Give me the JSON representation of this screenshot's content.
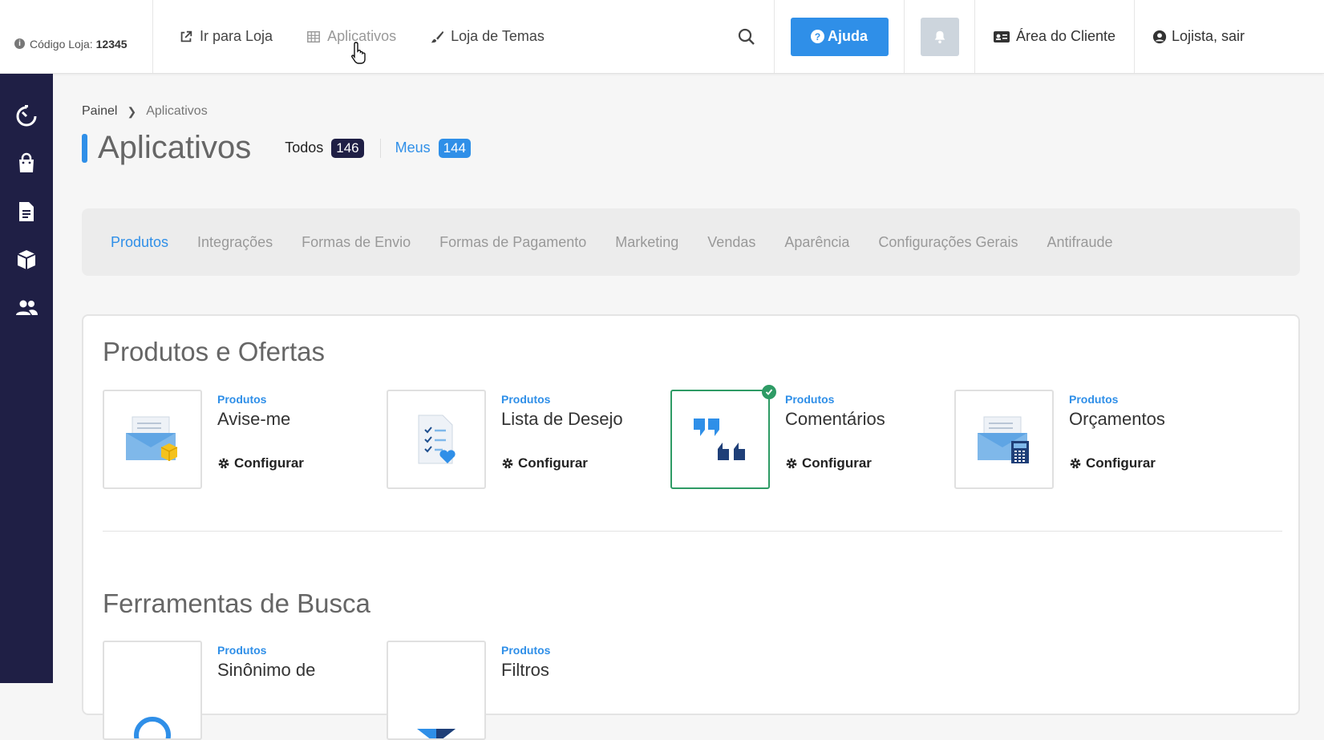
{
  "topbar": {
    "store_code_label": "Código Loja:",
    "store_code_value": "12345",
    "nav": [
      {
        "label": "Ir para Loja",
        "icon": "external-link-icon"
      },
      {
        "label": "Aplicativos",
        "icon": "grid-icon"
      },
      {
        "label": "Loja de Temas",
        "icon": "brush-icon"
      }
    ],
    "help_label": "Ajuda",
    "client_area_label": "Área do Cliente",
    "user_label": "Lojista, sair"
  },
  "sidebar": {
    "items": [
      "dashboard-icon",
      "shopping-bag-icon",
      "document-icon",
      "box-icon",
      "users-icon"
    ]
  },
  "breadcrumb": {
    "root": "Painel",
    "current": "Aplicativos"
  },
  "page": {
    "title": "Aplicativos",
    "all_label": "Todos",
    "all_count": "146",
    "mine_label": "Meus",
    "mine_count": "144"
  },
  "categories": [
    "Produtos",
    "Integrações",
    "Formas de Envio",
    "Formas de Pagamento",
    "Marketing",
    "Vendas",
    "Aparência",
    "Configurações Gerais",
    "Antifraude"
  ],
  "sections": [
    {
      "title": "Produtos e Ofertas",
      "apps": [
        {
          "category": "Produtos",
          "name": "Avise-me",
          "action": "Configurar",
          "installed": false
        },
        {
          "category": "Produtos",
          "name": "Lista de Desejo",
          "action": "Configurar",
          "installed": false
        },
        {
          "category": "Produtos",
          "name": "Comentários",
          "action": "Configurar",
          "installed": true
        },
        {
          "category": "Produtos",
          "name": "Orçamentos",
          "action": "Configurar",
          "installed": false
        }
      ]
    },
    {
      "title": "Ferramentas de Busca",
      "apps": [
        {
          "category": "Produtos",
          "name": "Sinônimo de"
        },
        {
          "category": "Produtos",
          "name": "Filtros"
        }
      ]
    }
  ],
  "colors": {
    "accent": "#2f8fe8",
    "sidebar": "#1f1f45",
    "installed": "#2e9b65"
  }
}
